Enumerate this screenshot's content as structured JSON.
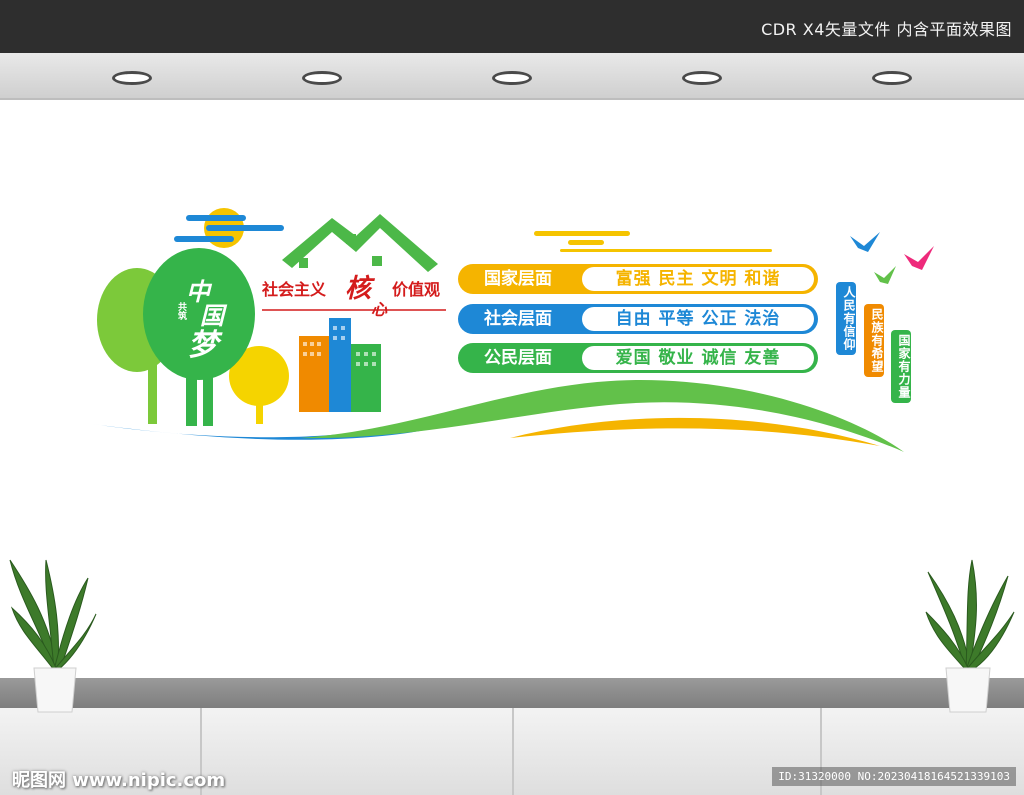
{
  "header": {
    "caption": "CDR X4矢量文件  内含平面效果图"
  },
  "board": {
    "title_prefix": "社会主义",
    "title_big": "核",
    "title_small": "心",
    "title_suffix": "价值观",
    "tree_small": "共筑",
    "tree_c1": "中",
    "tree_c2": "国",
    "tree_c3": "梦",
    "rows": [
      {
        "label": "国家层面",
        "values": "富强  民主  文明  和谐",
        "color": "#f5b400"
      },
      {
        "label": "社会层面",
        "values": "自由  平等  公正  法治",
        "color": "#1e88d6"
      },
      {
        "label": "公民层面",
        "values": "爱国  敬业  诚信  友善",
        "color": "#35b44a"
      }
    ],
    "tags": [
      {
        "text": "人民有信仰",
        "color": "#1e88d6"
      },
      {
        "text": "民族有希望",
        "color": "#f08a00"
      },
      {
        "text": "国家有力量",
        "color": "#35b44a"
      }
    ]
  },
  "footer": {
    "watermark": "昵图网 www.nipic.com",
    "id_text": "ID:31320000 NO:20230418164521339103"
  },
  "colors": {
    "green": "#35b44a",
    "light_green": "#7cc93a",
    "yellow": "#f5b400",
    "blue": "#1e88d6",
    "orange": "#f08a00",
    "red": "#d41c1c"
  }
}
